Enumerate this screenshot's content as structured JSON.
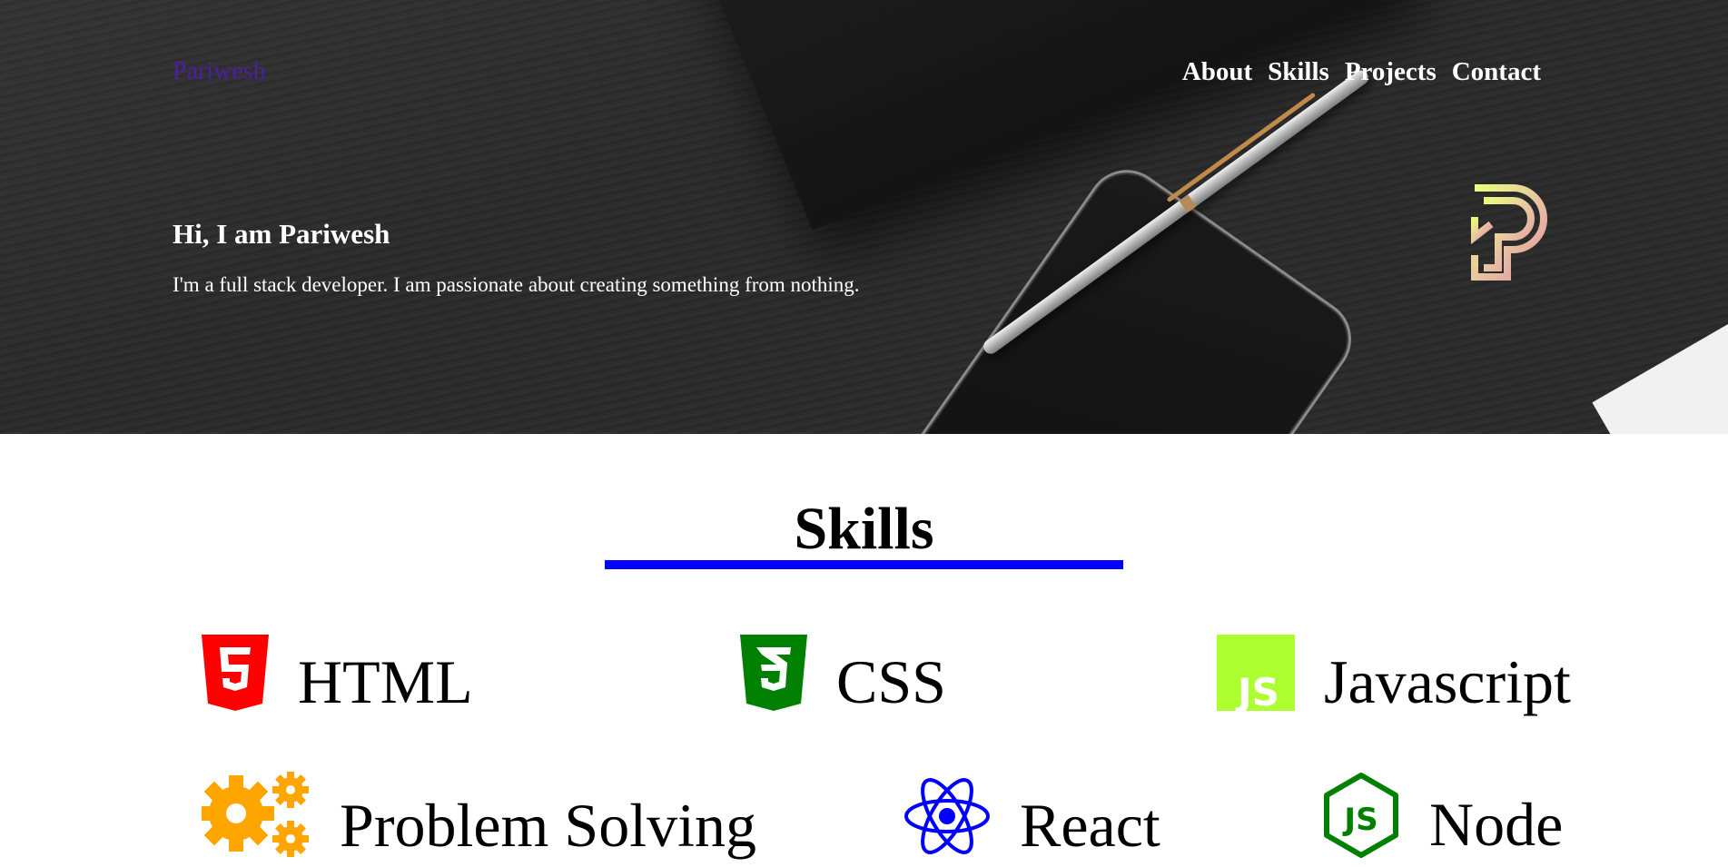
{
  "nav": {
    "brand": "Pariwesh",
    "links": [
      "About",
      "Skills",
      "Projects",
      "Contact"
    ]
  },
  "hero": {
    "title": "Hi, I am Pariwesh",
    "subtitle": "I'm a full stack developer. I am passionate about creating something from nothing.",
    "logo_icon": "pariwesh-p-logo"
  },
  "skills": {
    "heading": "Skills",
    "underline_color": "#0000ff",
    "items": [
      {
        "label": "HTML",
        "icon": "html5-icon",
        "color": "#ff0000"
      },
      {
        "label": "CSS",
        "icon": "css3-icon",
        "color": "#008000"
      },
      {
        "label": "Javascript",
        "icon": "javascript-icon",
        "color": "#adff2f"
      },
      {
        "label": "Problem Solving",
        "icon": "gears-icon",
        "color": "#ffa500"
      },
      {
        "label": "React",
        "icon": "react-icon",
        "color": "#0000ff"
      },
      {
        "label": "Node",
        "icon": "nodejs-icon",
        "color": "#008000"
      }
    ]
  }
}
